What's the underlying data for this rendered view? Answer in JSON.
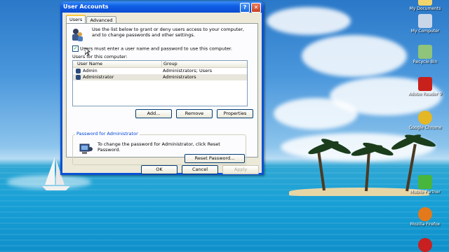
{
  "desktop": {
    "icons": [
      {
        "label": "My Documents",
        "icon": "folder-icon",
        "color": "#f2d46b"
      },
      {
        "label": "My Computer",
        "icon": "computer-icon",
        "color": "#c9d6e8"
      },
      {
        "label": "Recycle Bin",
        "icon": "recycle-bin-icon",
        "color": "#8fc47a"
      },
      {
        "label": "Adobe Reader 9",
        "icon": "adobe-reader-icon",
        "color": "#c8201a"
      },
      {
        "label": "Google Chrome",
        "icon": "chrome-icon",
        "color": "#e4b725"
      },
      {
        "label": "Mobile Partner",
        "icon": "mobile-partner-icon",
        "color": "#48b53c"
      },
      {
        "label": "Mozilla Firefox",
        "icon": "firefox-icon",
        "color": "#e3791a"
      }
    ]
  },
  "window": {
    "title": "User Accounts",
    "help_glyph": "?",
    "close_glyph": "✕",
    "tabs": [
      {
        "label": "Users",
        "active": true
      },
      {
        "label": "Advanced",
        "active": false
      }
    ],
    "intro_text": "Use the list below to grant or deny users access to your computer, and to change passwords and other settings.",
    "must_login_checkbox": {
      "label": "Users must enter a user name and password to use this computer.",
      "checked": true,
      "check_glyph": "✓"
    },
    "users_label": "Users for this computer:",
    "table": {
      "headers": [
        "User Name",
        "Group"
      ],
      "rows": [
        {
          "name": "Admin",
          "group": "Administrators; Users",
          "selected": false
        },
        {
          "name": "Administrator",
          "group": "Administrators",
          "selected": true
        }
      ]
    },
    "buttons": {
      "add": "Add...",
      "remove": "Remove",
      "properties": "Properties",
      "reset_password": "Reset Password...",
      "ok": "OK",
      "cancel": "Cancel",
      "apply": "Apply"
    },
    "password_group": {
      "title": "Password for Administrator",
      "text": "To change the password for Administrator, click Reset Password."
    }
  }
}
